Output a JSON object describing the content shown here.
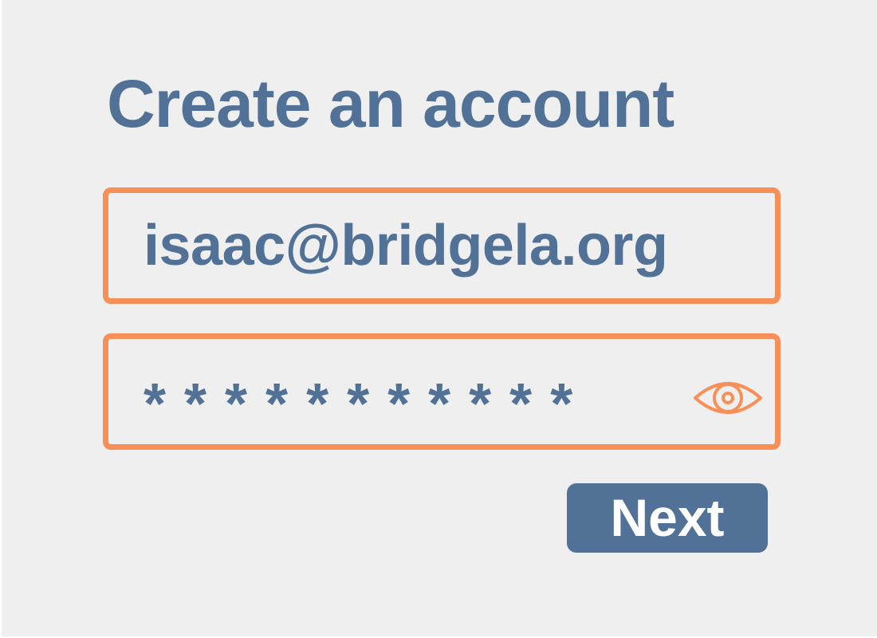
{
  "form": {
    "title": "Create an account",
    "email": {
      "value": "isaac@bridgela.org"
    },
    "password": {
      "masked_value": "***********",
      "toggle_icon": "eye-icon"
    },
    "next_label": "Next"
  },
  "colors": {
    "accent": "#f78f57",
    "primary": "#527196",
    "background": "#efefef"
  }
}
